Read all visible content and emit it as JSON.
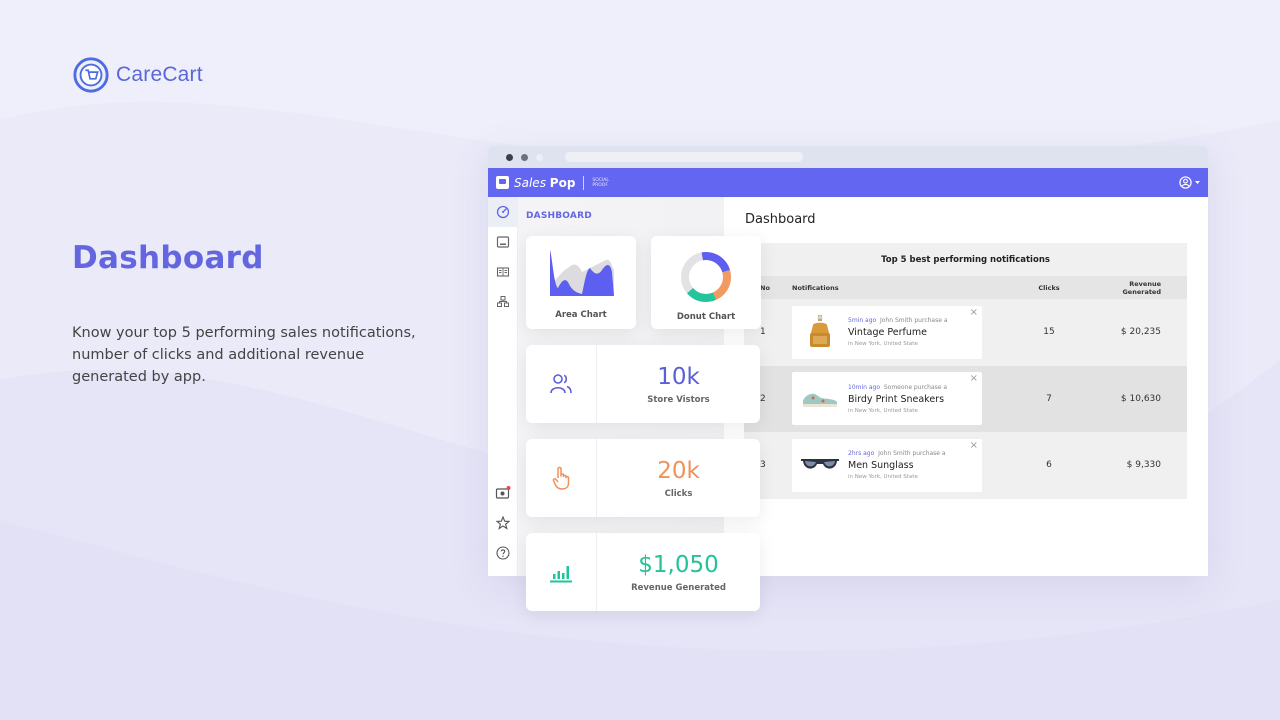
{
  "brand": {
    "name": "CareCart"
  },
  "hero": {
    "title": "Dashboard",
    "description": "Know your top 5 performing sales notifications, number of clicks and additional revenue generated by app."
  },
  "app": {
    "name_light": "Sales",
    "name_bold": "Pop",
    "tagline_1": "SOCIAL",
    "tagline_2": "PROOF",
    "accent_color": "#6366f1"
  },
  "sidebar": {
    "icons": [
      "dashboard-icon",
      "notifications-icon",
      "layout-icon",
      "integrations-icon"
    ],
    "bottom_icons": [
      "camera-icon",
      "star-icon",
      "help-icon"
    ],
    "nav_title": "DASHBOARD"
  },
  "main": {
    "title": "Dashboard",
    "table": {
      "caption": "Top 5 best performing notifications",
      "columns": [
        "No",
        "Notifications",
        "Clicks",
        "Revenue Generated"
      ],
      "rows": [
        {
          "no": "1",
          "time": "5min ago",
          "buyer": "John Smith purchase a",
          "product": "Vintage Perfume",
          "location": "in New York, United State",
          "clicks": "15",
          "revenue": "$ 20,235"
        },
        {
          "no": "2",
          "time": "10min ago",
          "buyer": "Someone purchase a",
          "product": "Birdy Print Sneakers",
          "location": "in New York, United State",
          "clicks": "7",
          "revenue": "$ 10,630"
        },
        {
          "no": "3",
          "time": "2hrs ago",
          "buyer": "John Smith purchase a",
          "product": "Men Sunglass",
          "location": "in New York, United State",
          "clicks": "6",
          "revenue": "$ 9,330"
        }
      ]
    }
  },
  "widgets": {
    "area_chart_label": "Area Chart",
    "donut_chart_label": "Donut Chart",
    "stats": [
      {
        "value": "10k",
        "label": "Store Vistors",
        "color": "#5b5fd6"
      },
      {
        "value": "20k",
        "label": "Clicks",
        "color": "#f0925a"
      },
      {
        "value": "$1,050",
        "label": "Revenue Generated",
        "color": "#22c39a"
      }
    ]
  }
}
